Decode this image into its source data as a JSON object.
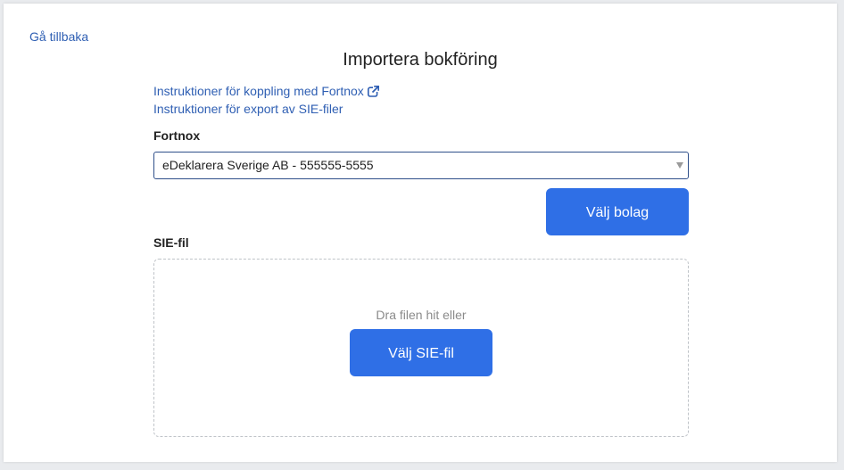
{
  "nav": {
    "back_label": "Gå tillbaka"
  },
  "page": {
    "title": "Importera bokföring"
  },
  "instructions": {
    "fortnox_link": "Instruktioner för koppling med Fortnox",
    "sie_link": "Instruktioner för export av SIE-filer",
    "external_icon": "external-link-icon"
  },
  "fortnox": {
    "label": "Fortnox",
    "selected_company": "eDeklarera Sverige AB - 555555-5555",
    "choose_button": "Välj bolag"
  },
  "sie": {
    "label": "SIE-fil",
    "drop_text": "Dra filen hit eller",
    "choose_button": "Välj SIE-fil"
  },
  "colors": {
    "link": "#2f5fb3",
    "primary_button": "#2f6fe6",
    "select_border": "#2f4f8a"
  }
}
